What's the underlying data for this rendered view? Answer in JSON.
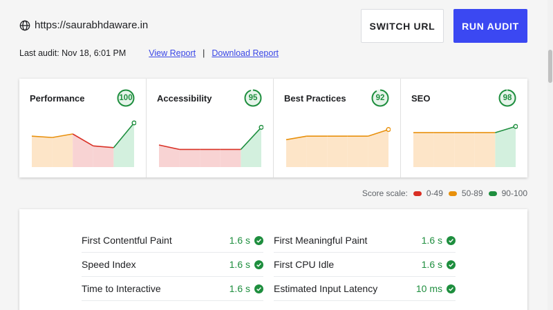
{
  "header": {
    "url": "https://saurabhdaware.in",
    "switch_label": "SWITCH URL",
    "run_label": "RUN AUDIT",
    "last_audit": "Last audit: Nov 18, 6:01 PM",
    "view_report": "View Report",
    "separator": "|",
    "download_report": "Download Report"
  },
  "colors": {
    "accent": "#3b48f2",
    "good": "#1e8e3e",
    "average": "#e8900c",
    "poor": "#d93025"
  },
  "cards": [
    {
      "title": "Performance",
      "score": "100",
      "history": [
        70,
        67,
        75,
        48,
        44,
        100
      ]
    },
    {
      "title": "Accessibility",
      "score": "95",
      "history": [
        50,
        40,
        40,
        40,
        40,
        90
      ]
    },
    {
      "title": "Best Practices",
      "score": "92",
      "history": [
        62,
        70,
        70,
        70,
        70,
        85
      ]
    },
    {
      "title": "SEO",
      "score": "98",
      "history": [
        78,
        78,
        78,
        78,
        78,
        92
      ]
    }
  ],
  "scale": {
    "label": "Score scale:",
    "poor": "0-49",
    "average": "50-89",
    "good": "90-100"
  },
  "metrics": {
    "left": [
      {
        "label": "First Contentful Paint",
        "value": "1.6 s"
      },
      {
        "label": "Speed Index",
        "value": "1.6 s"
      },
      {
        "label": "Time to Interactive",
        "value": "1.6 s"
      }
    ],
    "right": [
      {
        "label": "First Meaningful Paint",
        "value": "1.6 s"
      },
      {
        "label": "First CPU Idle",
        "value": "1.6 s"
      },
      {
        "label": "Estimated Input Latency",
        "value": "10 ms"
      }
    ]
  }
}
